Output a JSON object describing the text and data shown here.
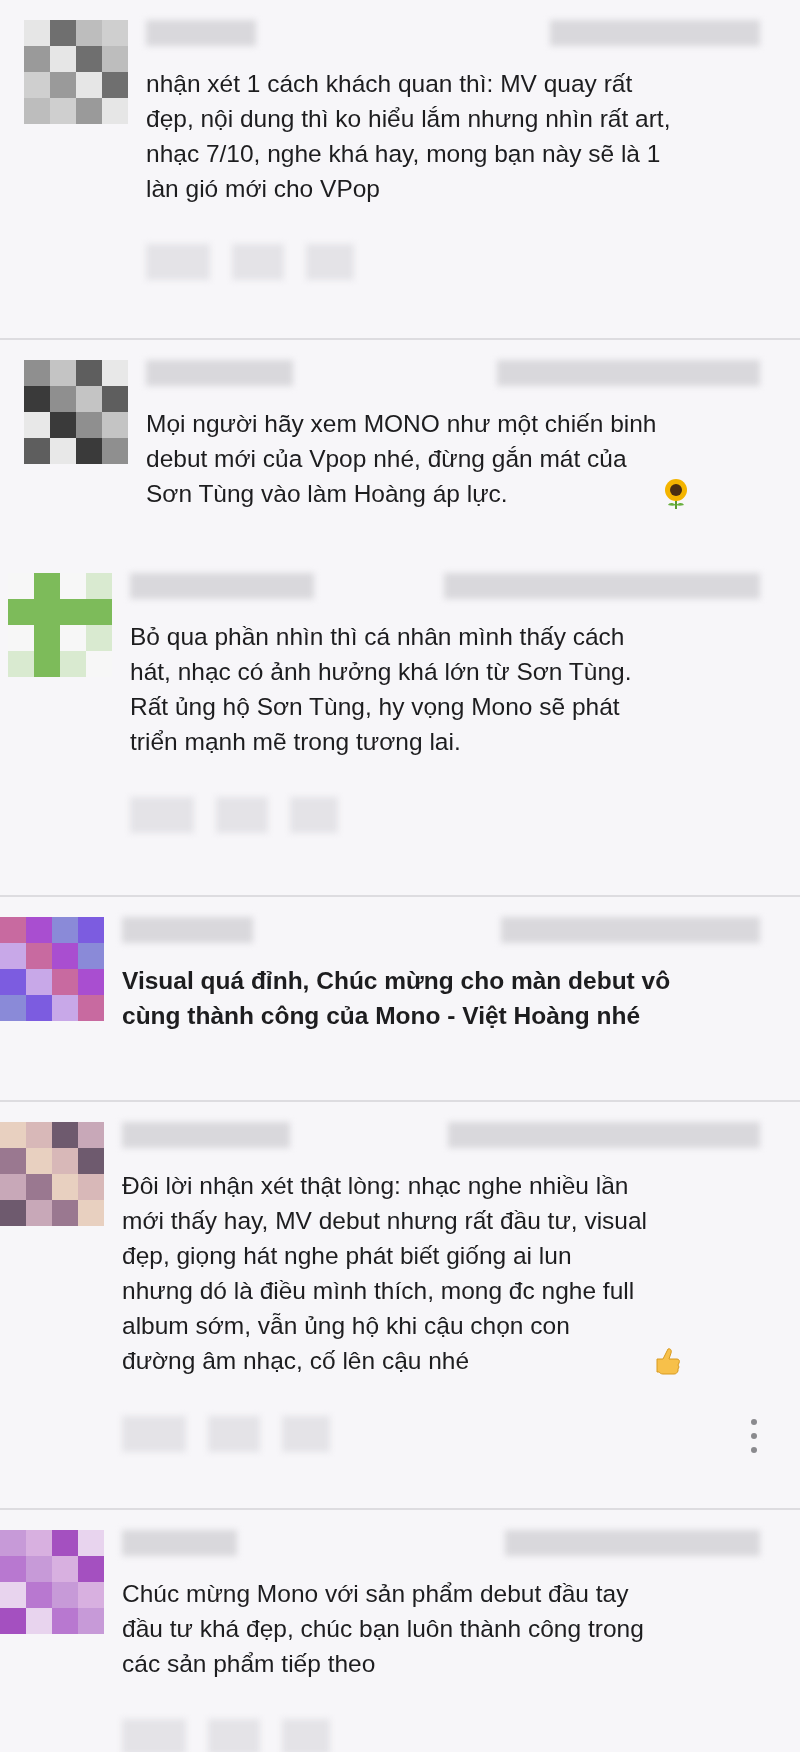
{
  "comments": [
    {
      "kind": "plain",
      "text": "nhận xét 1 cách khách quan thì: MV quay rất\nđẹp, nội dung thì ko hiểu lắm nhưng nhìn rất art,\nnhạc 7/10, nghe khá hay, mong bạn này sẽ là 1\nlàn gió mới cho VPop",
      "bold": false,
      "divider_above": false,
      "show_actions": true,
      "more_menu": false
    },
    {
      "kind": "sunflower",
      "text": "Mọi người hãy xem MONO như một chiến binh\ndebut mới của Vpop nhé, đừng gắn mát của\nSơn Tùng vào làm Hoàng áp lực.",
      "bold": false,
      "divider_above": true,
      "show_actions": false,
      "more_menu": false
    },
    {
      "kind": "plain",
      "text": "Bỏ qua phần nhìn thì cá nhân mình thấy cách\nhát, nhạc có ảnh hưởng khá lớn từ Sơn Tùng.\nRất ủng hộ Sơn Tùng, hy vọng Mono sẽ phát\ntriển mạnh mẽ trong tương lai.",
      "bold": false,
      "divider_above": false,
      "show_actions": true,
      "more_menu": false
    },
    {
      "kind": "plain",
      "text": "Visual quá đỉnh, Chúc mừng cho màn debut vô\ncùng thành công của Mono - Việt Hoàng nhé",
      "bold": true,
      "divider_above": true,
      "show_actions": false,
      "more_menu": false
    },
    {
      "kind": "thumbs_up",
      "text": "Đôi lời nhận xét thật lòng: nhạc nghe nhiều lần\nmới thấy hay, MV debut nhưng rất đầu tư, visual\nđẹp, giọng hát nghe phát biết giống ai lun\nnhưng dó là điều mình thích, mong đc nghe full\nalbum sớm, vẫn ủng hộ khi cậu chọn con\nđường âm nhạc, cố lên cậu nhé",
      "bold": false,
      "divider_above": true,
      "show_actions": true,
      "more_menu": true
    },
    {
      "kind": "plain",
      "text": "Chúc mừng Mono với sản phẩm debut đầu tay\nđầu tư khá đẹp, chúc bạn luôn thành công trong\ncác sản phẩm tiếp theo",
      "bold": false,
      "divider_above": true,
      "show_actions": true,
      "more_menu": false
    }
  ]
}
